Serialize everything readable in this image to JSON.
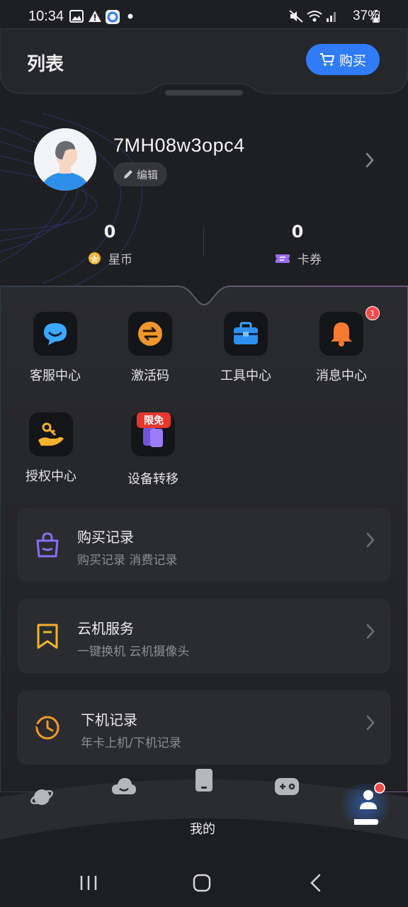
{
  "status_bar": {
    "time": "10:34",
    "battery": "37%",
    "icons": [
      "gallery-icon",
      "warning-icon",
      "app-icon",
      "dot-icon",
      "mute-icon",
      "wifi-icon",
      "signal-icon",
      "battery-icon"
    ]
  },
  "header": {
    "title": "列表",
    "buy_label": "购买"
  },
  "profile": {
    "username": "7MH08w3opc4",
    "edit_label": "编辑"
  },
  "stats": [
    {
      "value": "0",
      "label": "星币",
      "icon": "coin-icon"
    },
    {
      "value": "0",
      "label": "卡券",
      "icon": "ticket-icon"
    }
  ],
  "grid": [
    {
      "label": "客服中心",
      "icon": "chat-icon"
    },
    {
      "label": "激活码",
      "icon": "exchange-icon"
    },
    {
      "label": "工具中心",
      "icon": "toolbox-icon"
    },
    {
      "label": "消息中心",
      "icon": "bell-icon",
      "badge": "1"
    },
    {
      "label": "授权中心",
      "icon": "key-hand-icon"
    },
    {
      "label": "设备转移",
      "icon": "device-transfer-icon",
      "tag": "限免"
    }
  ],
  "cards": [
    {
      "title": "购买记录",
      "subtitle": "购买记录 消费记录",
      "icon": "bag-icon"
    },
    {
      "title": "云机服务",
      "subtitle": "一键换机 云机摄像头",
      "icon": "bookmark-icon"
    },
    {
      "title": "下机记录",
      "subtitle": "年卡上机/下机记录",
      "icon": "clock-icon"
    }
  ],
  "bottom_nav": {
    "active_label": "我的",
    "items": [
      "planet-icon",
      "cloud-icon",
      "phone-icon",
      "gamepad-icon",
      "user-icon"
    ]
  },
  "colors": {
    "accent": "#2f7cf6",
    "background": "#1e1f22",
    "card": "#2b2c30",
    "badge": "#f24a4a"
  }
}
